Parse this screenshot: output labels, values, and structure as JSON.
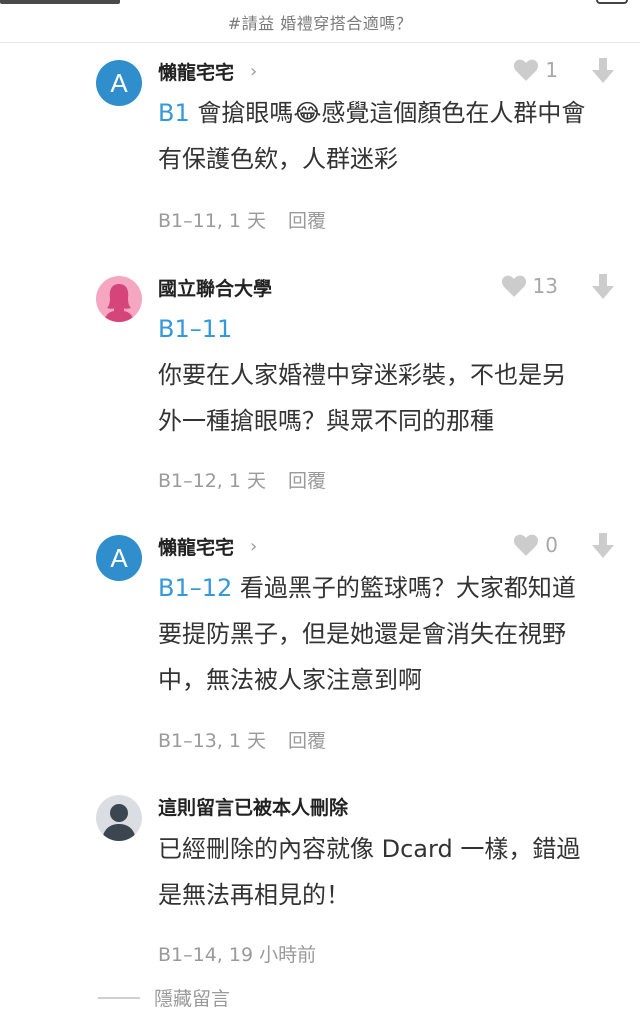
{
  "header": {
    "title": "#請益 婚禮穿搭合適嗎？"
  },
  "comments": [
    {
      "avatar_letter": "A",
      "author": "懶龍宅宅",
      "likes": "1",
      "ref": "B1",
      "line1": " 會搶眼嗎",
      "emoji": "😂",
      "line1b": "感覺這個顏色在人群中會",
      "line2": "有保護色欸，人群迷彩",
      "floor_time": "B1–11, 1 天",
      "reply": "回覆"
    },
    {
      "author": "國立聯合大學",
      "likes": "13",
      "ref": "B1–11",
      "line2": "你要在人家婚禮中穿迷彩裝，不也是另",
      "line3": "外一種搶眼嗎？與眾不同的那種",
      "floor_time": "B1–12, 1 天",
      "reply": "回覆"
    },
    {
      "avatar_letter": "A",
      "author": "懶龍宅宅",
      "likes": "0",
      "ref": "B1–12",
      "line1": " 看過黑子的籃球嗎？大家都知道",
      "line2": "要提防黑子，但是她還是會消失在視野",
      "line3": "中，無法被人家注意到啊",
      "floor_time": "B1–13, 1 天",
      "reply": "回覆"
    },
    {
      "author": "這則留言已被本人刪除",
      "line1": "已經刪除的內容就像 Dcard 一樣，錯過",
      "line2": "是無法再相見的！",
      "floor_time": "B1–14, 19 小時前"
    }
  ],
  "footer": {
    "hide_comments": "隱藏留言"
  },
  "colors": {
    "accent": "#3498db",
    "avatar_blue": "#2f8ecb",
    "avatar_pink": "#f5a6c0",
    "muted": "#9a9a9a"
  },
  "icons": [
    "heart-icon",
    "down-arrow-icon",
    "chevron-right-icon",
    "female-silhouette-icon",
    "person-silhouette-icon"
  ]
}
